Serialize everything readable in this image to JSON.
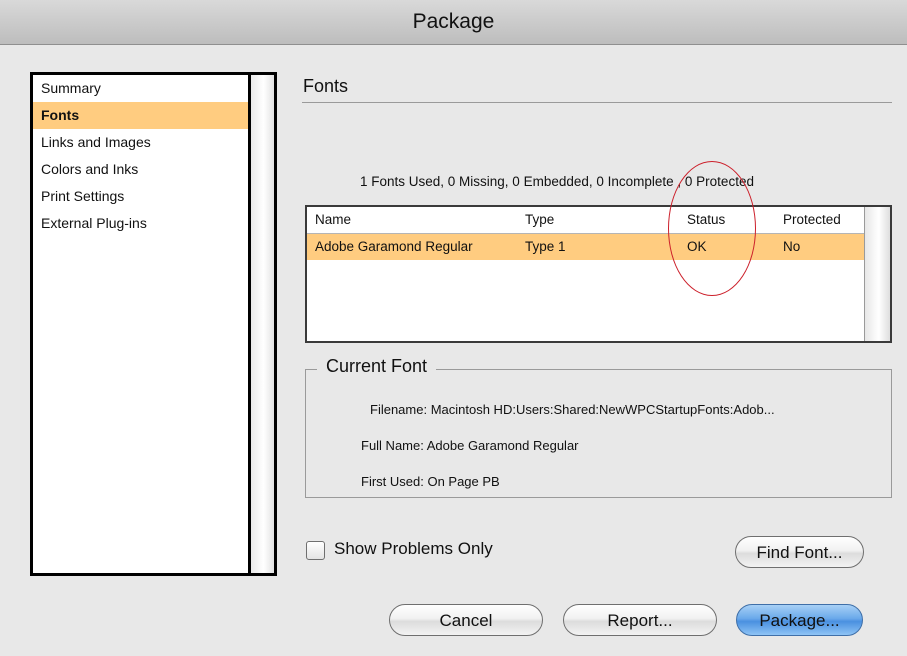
{
  "window": {
    "title": "Package"
  },
  "sidebar": {
    "items": [
      {
        "label": "Summary",
        "selected": false
      },
      {
        "label": "Fonts",
        "selected": true
      },
      {
        "label": "Links and Images",
        "selected": false
      },
      {
        "label": "Colors and Inks",
        "selected": false
      },
      {
        "label": "Print Settings",
        "selected": false
      },
      {
        "label": "External Plug-ins",
        "selected": false
      }
    ]
  },
  "main": {
    "section_title": "Fonts",
    "summary": "1 Fonts Used, 0 Missing, 0 Embedded, 0 Incomplete , 0 Protected",
    "table": {
      "columns": [
        "Name",
        "Type",
        "Status",
        "Protected"
      ],
      "rows": [
        {
          "name": "Adobe Garamond Regular",
          "type": "Type 1",
          "status": "OK",
          "protected": "No",
          "selected": true
        }
      ]
    },
    "current_font": {
      "legend": "Current Font",
      "filename": "Filename:  Macintosh HD:Users:Shared:NewWPCStartupFonts:Adob...",
      "full_name": "Full Name: Adobe Garamond Regular",
      "first_used": "First Used: On Page PB"
    },
    "show_problems_label": "Show Problems Only",
    "show_problems_checked": false
  },
  "buttons": {
    "find_font": "Find Font...",
    "cancel": "Cancel",
    "report": "Report...",
    "package": "Package..."
  },
  "colors": {
    "selection": "#ffcc80",
    "annotation": "#cc1f2a",
    "default_button": "#4a90e0"
  }
}
